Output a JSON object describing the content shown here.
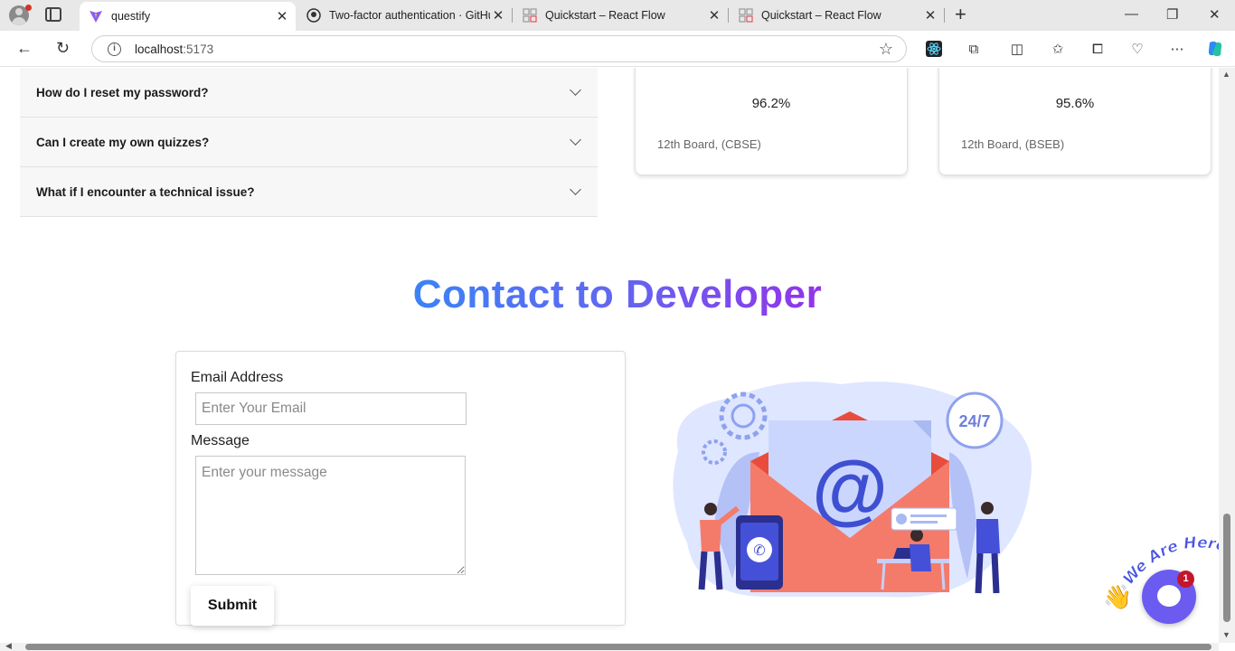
{
  "browser": {
    "tabs": [
      {
        "title": "questify",
        "active": true
      },
      {
        "title": "Two-factor authentication · GitHub",
        "active": false
      },
      {
        "title": "Quickstart – React Flow",
        "active": false
      },
      {
        "title": "Quickstart – React Flow",
        "active": false
      }
    ],
    "url_host": "localhost",
    "url_port": ":5173"
  },
  "faq": {
    "items": [
      {
        "question": "How do I reset my password?"
      },
      {
        "question": "Can I create my own quizzes?"
      },
      {
        "question": "What if I encounter a technical issue?"
      }
    ]
  },
  "scores": [
    {
      "value": "96.2%",
      "board": "12th Board, (CBSE)"
    },
    {
      "value": "95.6%",
      "board": "12th Board, (BSEB)"
    }
  ],
  "contact": {
    "title": "Contact to Developer",
    "email_label": "Email Address",
    "email_placeholder": "Enter Your Email",
    "message_label": "Message",
    "message_placeholder": "Enter your message",
    "submit_label": "Submit"
  },
  "illustration": {
    "badge_text": "24/7"
  },
  "chat_widget": {
    "text": "We Are Here!",
    "badge_count": "1"
  },
  "colors": {
    "title_gradient_start": "#3b82f6",
    "title_gradient_end": "#9333ea",
    "chat_bubble": "#6b5bf0",
    "illus_envelope": "#f47b6a"
  }
}
